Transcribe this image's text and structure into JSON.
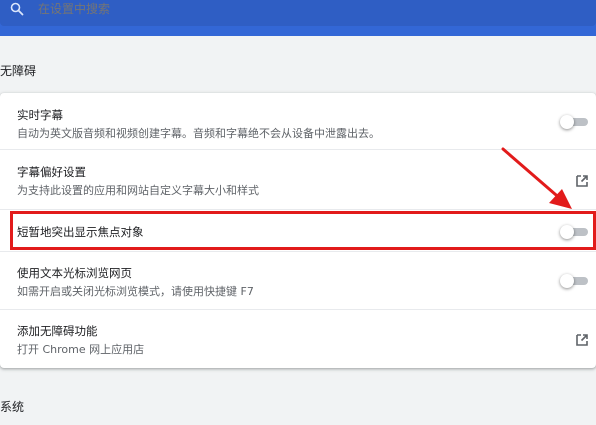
{
  "search": {
    "placeholder": "在设置中搜索"
  },
  "sections": {
    "accessibility": "无障碍",
    "system": "系统"
  },
  "rows": [
    {
      "title": "实时字幕",
      "subtitle": "自动为英文版音频和视频创建字幕。音频和字幕绝不会从设备中泄露出去。",
      "control": "toggle",
      "on": false
    },
    {
      "title": "字幕偏好设置",
      "subtitle": "为支持此设置的应用和网站自定义字幕大小和样式",
      "control": "external-link-icon"
    },
    {
      "title": "短暂地突出显示焦点对象",
      "subtitle": "",
      "control": "toggle",
      "on": false
    },
    {
      "title": "使用文本光标浏览网页",
      "subtitle": "如需开启或关闭光标浏览模式，请使用快捷键 F7",
      "control": "toggle",
      "on": false
    },
    {
      "title": "添加无障碍功能",
      "subtitle": "打开 Chrome 网上应用店",
      "control": "external-link-icon"
    }
  ],
  "annotation": {
    "color": "#e21b1b"
  },
  "colors": {
    "header": "#3367d6",
    "toggle_track": "#bdc1c6"
  }
}
